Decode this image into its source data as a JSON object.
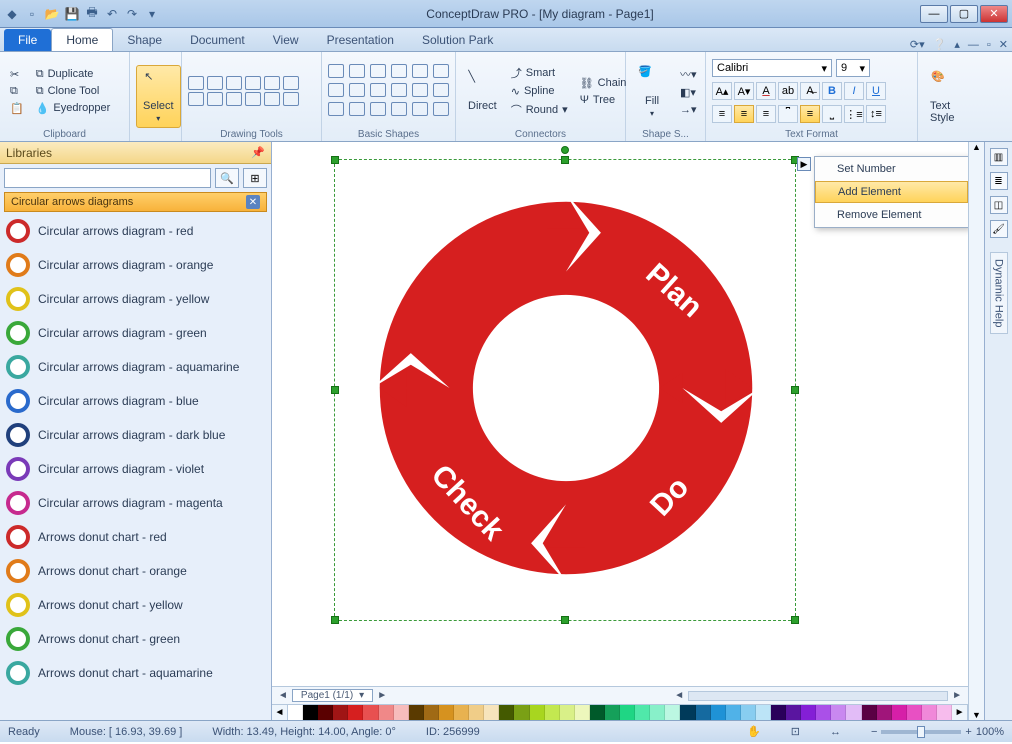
{
  "titlebar": {
    "title": "ConceptDraw PRO - [My diagram - Page1]"
  },
  "tabs": {
    "file": "File",
    "items": [
      "Home",
      "Shape",
      "Document",
      "View",
      "Presentation",
      "Solution Park"
    ],
    "active": 0
  },
  "ribbon": {
    "clipboard": {
      "label": "Clipboard",
      "duplicate": "Duplicate",
      "clone": "Clone Tool",
      "eyedropper": "Eyedropper"
    },
    "select": {
      "label": "Select"
    },
    "drawing": {
      "label": "Drawing Tools"
    },
    "shapes": {
      "label": "Basic Shapes"
    },
    "connectors": {
      "label": "Connectors",
      "direct": "Direct",
      "smart": "Smart",
      "spline": "Spline",
      "round": "Round",
      "chain": "Chain",
      "tree": "Tree"
    },
    "shapestyle": {
      "label": "Shape S...",
      "fill": "Fill"
    },
    "textformat": {
      "label": "Text Format",
      "font": "Calibri",
      "size": "9"
    },
    "textstyle": {
      "label": "Text Style"
    }
  },
  "libraries": {
    "title": "Libraries",
    "category": "Circular arrows diagrams",
    "items": [
      {
        "label": "Circular arrows diagram - red",
        "color": "#cc2a2a"
      },
      {
        "label": "Circular arrows diagram - orange",
        "color": "#e07b1a"
      },
      {
        "label": "Circular arrows diagram - yellow",
        "color": "#e0c21a"
      },
      {
        "label": "Circular arrows diagram - green",
        "color": "#3aa83a"
      },
      {
        "label": "Circular arrows diagram - aquamarine",
        "color": "#3aa8a0"
      },
      {
        "label": "Circular arrows diagram - blue",
        "color": "#2a6acc"
      },
      {
        "label": "Circular arrows diagram - dark blue",
        "color": "#20407c"
      },
      {
        "label": "Circular arrows diagram - violet",
        "color": "#7a3ab8"
      },
      {
        "label": "Circular arrows diagram - magenta",
        "color": "#c62a8e"
      },
      {
        "label": "Arrows donut chart - red",
        "color": "#cc2a2a"
      },
      {
        "label": "Arrows donut chart - orange",
        "color": "#e07b1a"
      },
      {
        "label": "Arrows donut chart - yellow",
        "color": "#e0c21a"
      },
      {
        "label": "Arrows donut chart - green",
        "color": "#3aa83a"
      },
      {
        "label": "Arrows donut chart - aquamarine",
        "color": "#3aa8a0"
      }
    ]
  },
  "diagram": {
    "segments": [
      "Plan",
      "Do",
      "Check"
    ]
  },
  "context_menu": {
    "items": [
      "Set Number",
      "Add Element",
      "Remove Element"
    ],
    "hover": 1
  },
  "page": {
    "label": "Page1 (1/1)"
  },
  "dynamic_help": "Dynamic Help",
  "colorbar": [
    "#ffffff",
    "#000000",
    "#5a0000",
    "#a01515",
    "#d61f1f",
    "#e85050",
    "#f08888",
    "#f7bcbc",
    "#5a3a00",
    "#a06a15",
    "#d6921f",
    "#e8b250",
    "#f0cd88",
    "#f7e4bc",
    "#445a00",
    "#7aa015",
    "#a8d61f",
    "#c3e850",
    "#d9f088",
    "#edf7bc",
    "#005a2a",
    "#15a05a",
    "#1fd684",
    "#50e8aa",
    "#88f0c9",
    "#bcf7e2",
    "#003a5a",
    "#156aa0",
    "#1f92d6",
    "#50b2e8",
    "#88cdf0",
    "#bce4f7",
    "#2a005a",
    "#5a15a0",
    "#841fd6",
    "#aa50e8",
    "#c988f0",
    "#e2bcf7",
    "#5a0044",
    "#a0157a",
    "#d61fa8",
    "#e850c3",
    "#f088d9",
    "#f7bced"
  ],
  "status": {
    "ready": "Ready",
    "mouse": "Mouse: [ 16.93, 39.69 ]",
    "size": "Width: 13.49,   Height: 14.00,   Angle: 0°",
    "id": "ID: 256999",
    "zoom": "100%"
  }
}
